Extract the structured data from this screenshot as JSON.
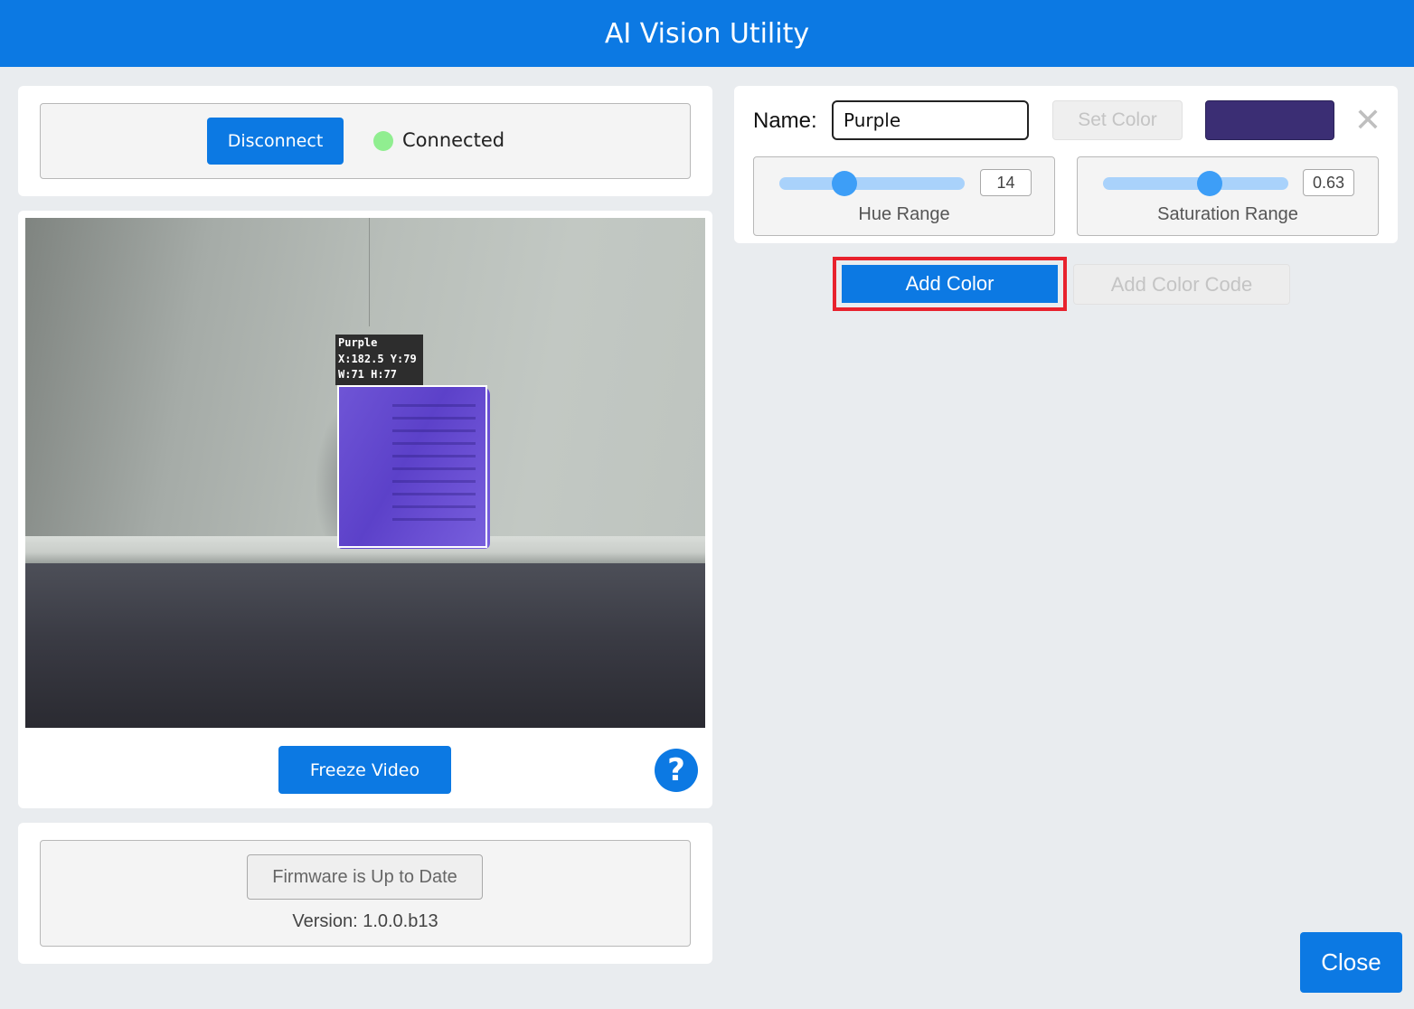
{
  "window": {
    "title": "AI Vision Utility"
  },
  "connection": {
    "button_label": "Disconnect",
    "status_text": "Connected",
    "status_color": "#90ee90"
  },
  "video": {
    "detection": {
      "name": "Purple",
      "coords": "X:182.5 Y:79",
      "size": "W:71 H:77"
    },
    "freeze_label": "Freeze Video",
    "help_glyph": "?"
  },
  "firmware": {
    "button_label": "Firmware is Up to Date",
    "version_text": "Version: 1.0.0.b13"
  },
  "color_editor": {
    "name_label": "Name:",
    "name_value": "Purple",
    "set_color_label": "Set Color",
    "swatch_color": "#3b2e74",
    "close_glyph": "✕",
    "hue": {
      "label": "Hue Range",
      "value": "14",
      "fraction": 0.33
    },
    "saturation": {
      "label": "Saturation Range",
      "value": "0.63",
      "fraction": 0.57
    }
  },
  "actions": {
    "add_color_label": "Add Color",
    "add_color_code_label": "Add Color Code"
  },
  "footer": {
    "close_label": "Close"
  }
}
